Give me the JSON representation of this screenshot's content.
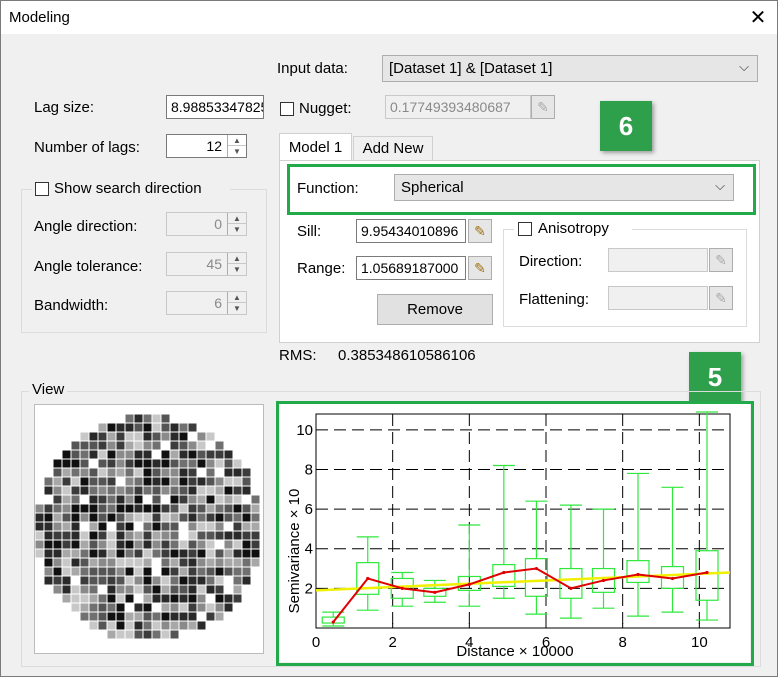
{
  "window": {
    "title": "Modeling",
    "close_glyph": "✕"
  },
  "input_data": {
    "label": "Input data:",
    "value": "[Dataset 1] & [Dataset 1]"
  },
  "lag_size": {
    "label": "Lag size:",
    "value": "8.98853347825"
  },
  "number_of_lags": {
    "label": "Number of lags:",
    "value": "12"
  },
  "nugget": {
    "label": "Nugget:",
    "value": "0.17749393480687",
    "checked": false
  },
  "show_search_direction": {
    "label": "Show search direction",
    "checked": false
  },
  "angle_direction": {
    "label": "Angle direction:",
    "value": "0"
  },
  "angle_tolerance": {
    "label": "Angle tolerance:",
    "value": "45"
  },
  "bandwidth": {
    "label": "Bandwidth:",
    "value": "6"
  },
  "tabs": [
    {
      "label": "Model 1"
    },
    {
      "label": "Add New"
    }
  ],
  "function": {
    "label": "Function:",
    "value": "Spherical"
  },
  "sill": {
    "label": "Sill:",
    "value": "9.95434010896"
  },
  "range": {
    "label": "Range:",
    "value": "1.05689187000"
  },
  "remove_button": {
    "label": "Remove"
  },
  "anisotropy": {
    "label": "Anisotropy",
    "checked": false
  },
  "direction": {
    "label": "Direction:",
    "value": ""
  },
  "flattening": {
    "label": "Flattening:",
    "value": ""
  },
  "rms": {
    "label": "RMS:",
    "value": "0.385348610586106"
  },
  "view": {
    "label": "View"
  },
  "badges": {
    "six": "6",
    "five": "5"
  },
  "colors": {
    "highlight": "#22a94a",
    "box": "#2ee83c",
    "line": "#e00000",
    "trend": "#f0f000"
  },
  "chart_data": {
    "type": "line",
    "xlabel": "Distance × 10000",
    "ylabel": "Semivariance × 10",
    "xlim": [
      0,
      10.8
    ],
    "ylim": [
      0,
      10.8
    ],
    "xticks": [
      "0",
      "2",
      "4",
      "6",
      "8",
      "10"
    ],
    "yticks": [
      "2",
      "4",
      "6",
      "8",
      "10"
    ],
    "grid": true,
    "boxes": [
      {
        "x": 0.45,
        "min": 0.1,
        "q1": 0.25,
        "q3": 0.55,
        "max": 0.8
      },
      {
        "x": 1.35,
        "min": 0.9,
        "q1": 1.7,
        "q3": 3.3,
        "max": 4.6
      },
      {
        "x": 2.25,
        "min": 1.1,
        "q1": 1.5,
        "q3": 2.5,
        "max": 2.8
      },
      {
        "x": 3.1,
        "min": 1.3,
        "q1": 1.6,
        "q3": 2.0,
        "max": 2.4
      },
      {
        "x": 4.0,
        "min": 1.1,
        "q1": 1.9,
        "q3": 2.6,
        "max": 5.2
      },
      {
        "x": 4.9,
        "min": 1.5,
        "q1": 2.1,
        "q3": 3.2,
        "max": 8.2
      },
      {
        "x": 5.75,
        "min": 0.7,
        "q1": 1.6,
        "q3": 3.5,
        "max": 6.4
      },
      {
        "x": 6.65,
        "min": 0.5,
        "q1": 1.5,
        "q3": 3.0,
        "max": 6.2
      },
      {
        "x": 7.5,
        "min": 1.0,
        "q1": 1.8,
        "q3": 3.0,
        "max": 6.0
      },
      {
        "x": 8.4,
        "min": 0.6,
        "q1": 2.3,
        "q3": 3.4,
        "max": 7.8
      },
      {
        "x": 9.3,
        "min": 0.8,
        "q1": 2.0,
        "q3": 3.1,
        "max": 7.1
      },
      {
        "x": 10.2,
        "min": 0.4,
        "q1": 1.4,
        "q3": 3.9,
        "max": 10.9
      }
    ],
    "series": [
      {
        "x": [
          0.45,
          1.35,
          2.25,
          3.1,
          4.0,
          4.9,
          5.75,
          6.65,
          7.5,
          8.4,
          9.3,
          10.2
        ],
        "values": [
          0.3,
          2.5,
          2.0,
          1.8,
          2.2,
          2.8,
          3.0,
          2.0,
          2.4,
          2.7,
          2.5,
          2.8
        ]
      },
      {
        "x": [
          0,
          10.8
        ],
        "values": [
          1.9,
          2.8
        ]
      }
    ]
  }
}
